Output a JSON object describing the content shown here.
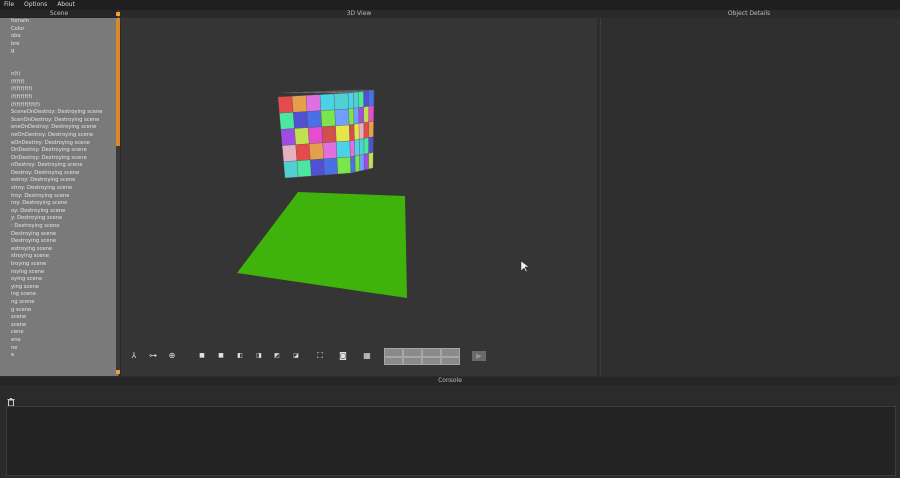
{
  "menu": {
    "file": "File",
    "options": "Options",
    "about": "About"
  },
  "panels": {
    "scene": "Scene",
    "view3d": "3D View",
    "details": "Object Details",
    "console": "Console"
  },
  "scene_items": [
    "fomain",
    "Color",
    "obe",
    "bre",
    "g",
    "",
    "",
    "n(t)",
    "(f(f(f)",
    "(f(f(f(f(f)",
    "(f(f(f(f(f)",
    "(f(f(f(f(f(f(f)",
    "SceneOnDestroy: Destroying scene",
    "ScenOnDestroy: Destroying scene",
    "eneOnDestroy: Destroying scene",
    "neOnDestroy: Destroying scene",
    "eOnDestroy: Destroying scene",
    "OnDestroy: Destroying scene",
    "OnDestroy: Destroying scene",
    "nDestroy: Destroying scene",
    "Destroy: Destroying scene",
    "estroy: Destroying scene",
    "stroy: Destroying scene",
    "troy: Destroying scene",
    "roy: Destroying scene",
    "oy: Destroying scene",
    "y: Destroying scene",
    ": Destroying scene",
    "Destroying scene",
    "Destroying scene",
    "estroying scene",
    "stroying scene",
    "troying scene",
    "roying scene",
    "oying scene",
    "ying scene",
    "ing scene",
    "ng scene",
    "g scene",
    " scene",
    "scene",
    "cene",
    "ene",
    "ne",
    "e"
  ],
  "colors": {
    "menubar": "#1f1f1f",
    "scene_bg": "#7a7a7a",
    "view_bg": "#353535",
    "plane": "#3fb30b",
    "scroll_accent": "#d9892a"
  },
  "toolbar_icons": [
    "axes-icon",
    "ruler-icon",
    "target-icon",
    "view-front-icon",
    "view-back-icon",
    "view-left-icon",
    "view-right-icon",
    "view-top-icon",
    "view-bottom-icon",
    "fit-view-icon",
    "camera-icon",
    "grid-icon",
    "play-icon"
  ]
}
